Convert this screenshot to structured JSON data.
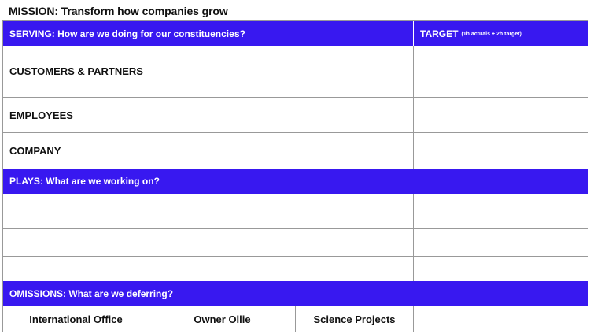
{
  "mission": "MISSION: Transform how companies grow",
  "serving": {
    "header": "SERVING: How are we doing for our constituencies?",
    "target_label": "TARGET",
    "target_note": "(1h actuals + 2h target)",
    "rows": [
      "CUSTOMERS & PARTNERS",
      "EMPLOYEES",
      "COMPANY"
    ]
  },
  "plays": {
    "header": "PLAYS: What are we working on?"
  },
  "omissions": {
    "header": "OMISSIONS: What are we deferring?",
    "items": [
      "International Office",
      "Owner Ollie",
      "Science Projects",
      ""
    ]
  },
  "colors": {
    "header_blue": "#3818f0",
    "grid_line": "#999999"
  }
}
